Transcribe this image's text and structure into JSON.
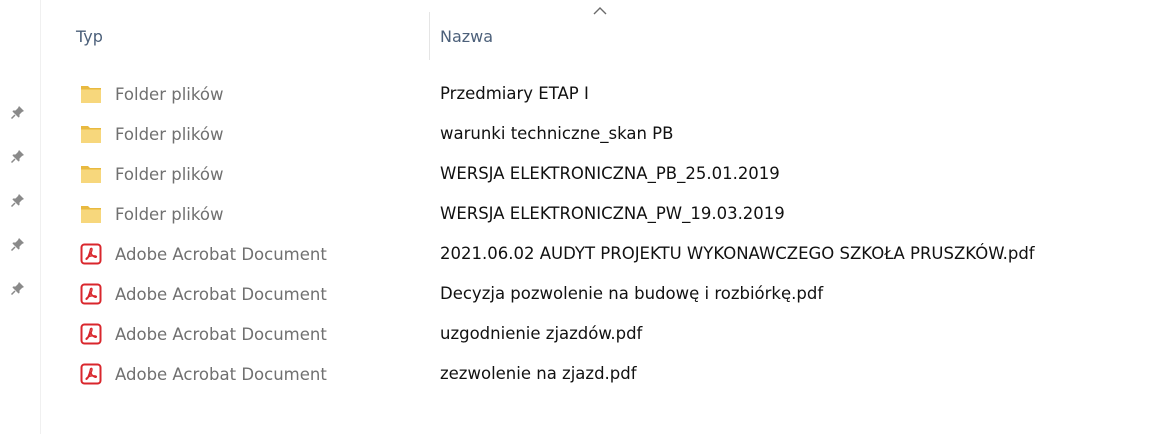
{
  "header": {
    "col_type": "Typ",
    "col_name": "Nazwa",
    "sort_direction": "ascending"
  },
  "quick_access_pins": 5,
  "icons": {
    "folder": "folder-icon",
    "pdf": "pdf-icon",
    "pin": "pin-icon",
    "sort": "sort-ascending-icon"
  },
  "colors": {
    "folder": "#f7d77c",
    "pdf": "#d9262c",
    "header_text": "#4c607a",
    "type_text": "#707070",
    "name_text": "#111111"
  },
  "rows": [
    {
      "kind": "folder",
      "type": "Folder plików",
      "name": "Przedmiary ETAP I"
    },
    {
      "kind": "folder",
      "type": "Folder plików",
      "name": "warunki techniczne_skan PB"
    },
    {
      "kind": "folder",
      "type": "Folder plików",
      "name": "WERSJA ELEKTRONICZNA_PB_25.01.2019"
    },
    {
      "kind": "folder",
      "type": "Folder plików",
      "name": "WERSJA ELEKTRONICZNA_PW_19.03.2019"
    },
    {
      "kind": "pdf",
      "type": "Adobe Acrobat Document",
      "name": "2021.06.02 AUDYT PROJEKTU WYKONAWCZEGO SZKOŁA PRUSZKÓW.pdf"
    },
    {
      "kind": "pdf",
      "type": "Adobe Acrobat Document",
      "name": "Decyzja pozwolenie na budowę i rozbiórkę.pdf"
    },
    {
      "kind": "pdf",
      "type": "Adobe Acrobat Document",
      "name": "uzgodnienie zjazdów.pdf"
    },
    {
      "kind": "pdf",
      "type": "Adobe Acrobat Document",
      "name": "zezwolenie na zjazd.pdf"
    }
  ]
}
